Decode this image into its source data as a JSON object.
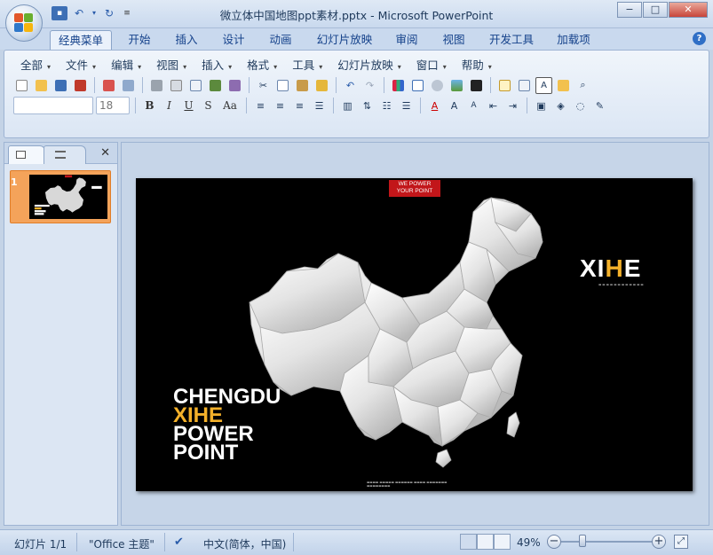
{
  "window": {
    "title": "微立体中国地图ppt素材.pptx - Microsoft PowerPoint",
    "controls": [
      "−",
      "□",
      "✕"
    ]
  },
  "quick_access": [
    "save",
    "undo",
    "redo",
    "customize"
  ],
  "tabs": [
    {
      "label": "经典菜单",
      "active": true
    },
    {
      "label": "开始"
    },
    {
      "label": "插入"
    },
    {
      "label": "设计"
    },
    {
      "label": "动画"
    },
    {
      "label": "幻灯片放映"
    },
    {
      "label": "审阅"
    },
    {
      "label": "视图"
    },
    {
      "label": "开发工具"
    },
    {
      "label": "加载项"
    }
  ],
  "menus": [
    "全部",
    "文件",
    "编辑",
    "视图",
    "插入",
    "格式",
    "工具",
    "幻灯片放映",
    "窗口",
    "帮助"
  ],
  "font_size_value": "18",
  "format_buttons": [
    "B",
    "I",
    "U",
    "S",
    "Aa"
  ],
  "slide_panel": {
    "slide_number": "1"
  },
  "slide": {
    "tag_line1": "WE POWER",
    "tag_line2": "YOUR POINT",
    "brand_prefix": "XI",
    "brand_highlight": "H",
    "brand_suffix": "E",
    "text_lines": [
      "CHENGDU",
      "XIHE",
      "POWER",
      "POINT"
    ]
  },
  "status": {
    "slide_info": "幻灯片 1/1",
    "theme": "\"Office 主题\"",
    "language": "中文(简体，中国)",
    "zoom": "49%"
  },
  "colors": {
    "accent_yellow": "#f4b12a",
    "tag_red": "#c2161a",
    "thumb_highlight": "#f4a35a"
  }
}
